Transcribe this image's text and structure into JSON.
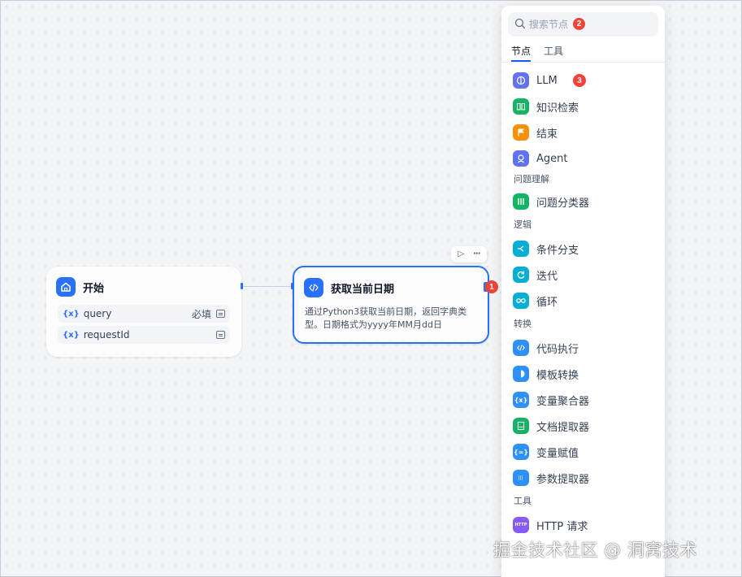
{
  "canvas": {
    "start_node": {
      "title": "开始",
      "variables": [
        {
          "symbol": "{x}",
          "name": "query",
          "required": "必填"
        },
        {
          "symbol": "{x}",
          "name": "requestId",
          "required": ""
        }
      ]
    },
    "code_node": {
      "title": "获取当前日期",
      "description": "通过Python3获取当前日期，返回字典类型。日期格式为yyyy年MM月dd日"
    },
    "toolbar": {
      "run_icon": "play-icon",
      "more_icon": "more-icon"
    },
    "badges": {
      "b1": "1",
      "b2": "2",
      "b3": "3"
    }
  },
  "panel": {
    "search": {
      "placeholder": "搜索节点"
    },
    "tabs": [
      {
        "label": "节点"
      },
      {
        "label": "工具"
      }
    ],
    "items_top": [
      {
        "label": "LLM",
        "icon": "llm-icon",
        "color": "#6172f3"
      },
      {
        "label": "知识检索",
        "icon": "knowledge-icon",
        "color": "#16b364"
      },
      {
        "label": "结束",
        "icon": "end-icon",
        "color": "#f79009"
      },
      {
        "label": "Agent",
        "icon": "agent-icon",
        "color": "#6172f3"
      }
    ],
    "sections": [
      {
        "title": "问题理解",
        "items": [
          {
            "label": "问题分类器",
            "icon": "classifier-icon",
            "color": "#16b364"
          }
        ]
      },
      {
        "title": "逻辑",
        "items": [
          {
            "label": "条件分支",
            "icon": "branch-icon",
            "color": "#06aed4"
          },
          {
            "label": "迭代",
            "icon": "iteration-icon",
            "color": "#06aed4"
          },
          {
            "label": "循环",
            "icon": "loop-icon",
            "color": "#06aed4"
          }
        ]
      },
      {
        "title": "转换",
        "items": [
          {
            "label": "代码执行",
            "icon": "code-icon",
            "color": "#2e90fa"
          },
          {
            "label": "模板转换",
            "icon": "template-icon",
            "color": "#2e90fa"
          },
          {
            "label": "变量聚合器",
            "icon": "aggregator-icon",
            "color": "#2e90fa"
          },
          {
            "label": "文档提取器",
            "icon": "doc-extractor-icon",
            "color": "#16b364"
          },
          {
            "label": "变量赋值",
            "icon": "assign-icon",
            "color": "#2e90fa"
          },
          {
            "label": "参数提取器",
            "icon": "param-extractor-icon",
            "color": "#2e90fa"
          }
        ]
      },
      {
        "title": "工具",
        "items": [
          {
            "label": "HTTP 请求",
            "icon": "http-icon",
            "color": "#875bf7"
          }
        ]
      }
    ]
  },
  "watermark": "掘金技术社区 @ 洞窝技术"
}
